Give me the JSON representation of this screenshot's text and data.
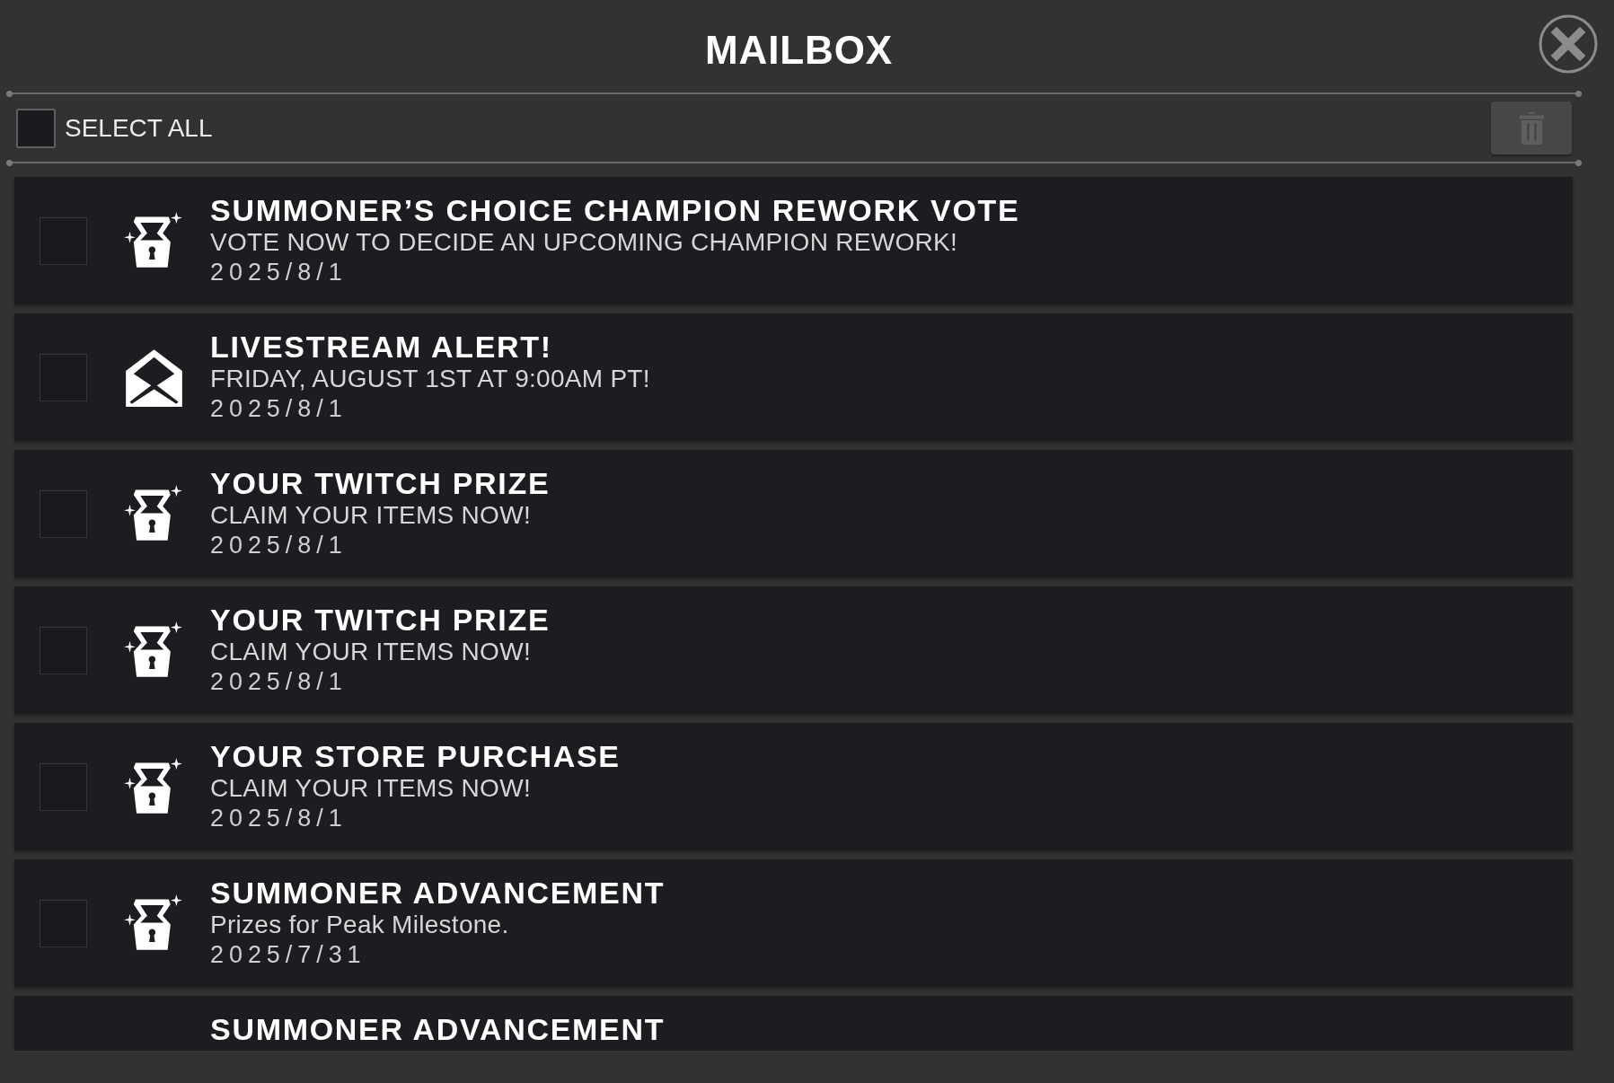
{
  "window": {
    "title": "MAILBOX"
  },
  "toolbar": {
    "select_all": {
      "label": "SELECT ALL",
      "checked": false
    },
    "delete_button": {
      "disabled": true
    }
  },
  "messages": [
    {
      "kind": "chest",
      "checked": false,
      "title": "SUMMONER’S CHOICE CHAMPION REWORK VOTE",
      "body": "VOTE NOW TO DECIDE AN UPCOMING CHAMPION REWORK!",
      "date": "2025/8/1"
    },
    {
      "kind": "envelope",
      "checked": false,
      "title": "LIVESTREAM ALERT!",
      "body": "FRIDAY, AUGUST 1ST AT 9:00AM PT!",
      "date": "2025/8/1"
    },
    {
      "kind": "chest",
      "checked": false,
      "title": "YOUR TWITCH PRIZE",
      "body": "CLAIM YOUR ITEMS NOW!",
      "date": "2025/8/1"
    },
    {
      "kind": "chest",
      "checked": false,
      "title": "YOUR TWITCH PRIZE",
      "body": "CLAIM YOUR ITEMS NOW!",
      "date": "2025/8/1"
    },
    {
      "kind": "chest",
      "checked": false,
      "title": "YOUR STORE PURCHASE",
      "body": "CLAIM YOUR ITEMS NOW!",
      "date": "2025/8/1"
    },
    {
      "kind": "chest",
      "checked": false,
      "title": "SUMMONER ADVANCEMENT",
      "body": "Prizes for Peak Milestone.",
      "date": "2025/7/31"
    },
    {
      "title": "SUMMONER ADVANCEMENT"
    }
  ]
}
